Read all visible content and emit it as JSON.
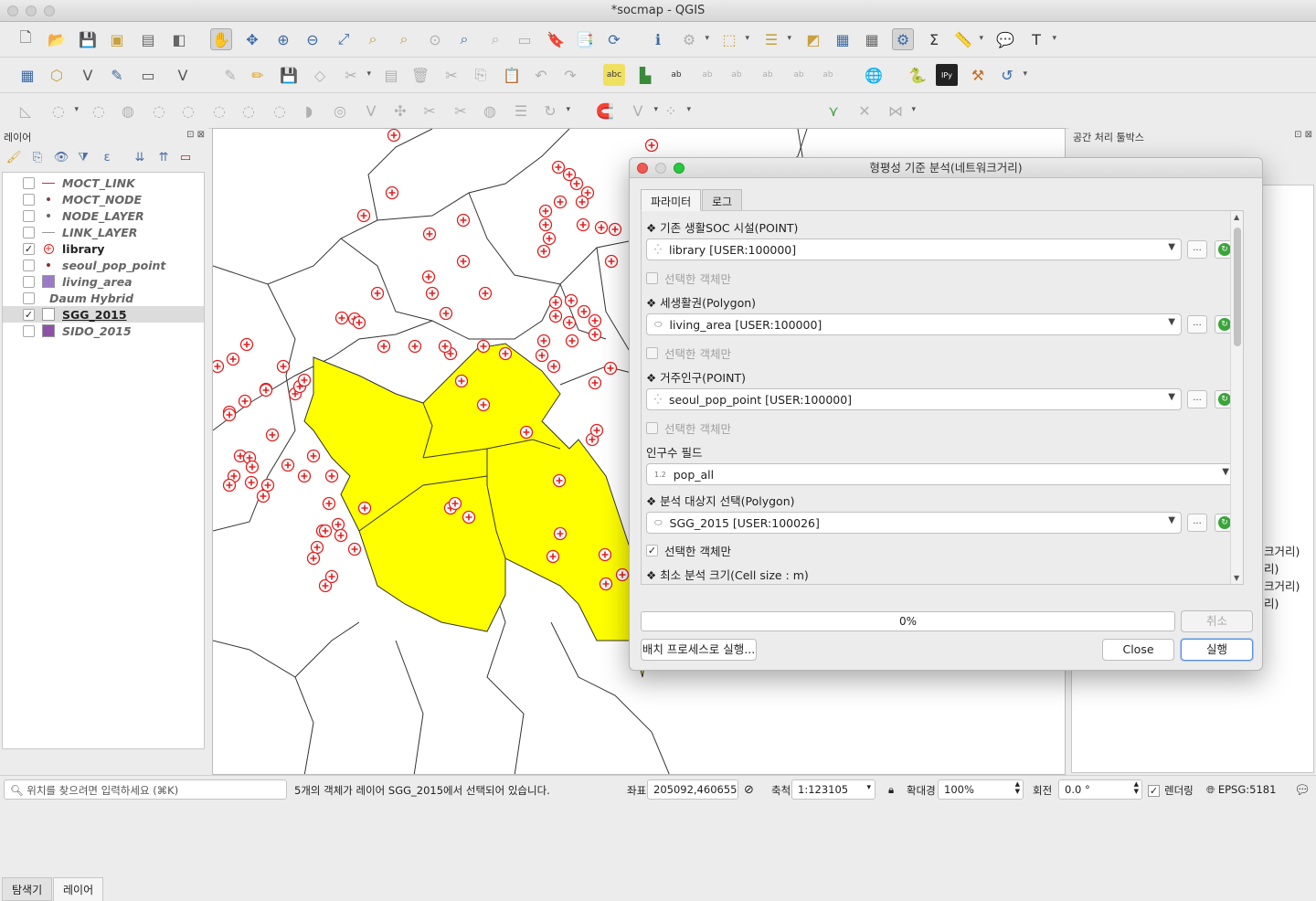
{
  "window": {
    "title": "*socmap - QGIS"
  },
  "toolbar": {
    "scale_value": "12",
    "unit": "px"
  },
  "layers_panel": {
    "title": "레이어",
    "items": [
      {
        "name": "MOCT_LINK",
        "checked": false,
        "symbol": "line",
        "color": "#b03a3a"
      },
      {
        "name": "MOCT_NODE",
        "checked": false,
        "symbol": "dot",
        "color": "#8a4040"
      },
      {
        "name": "NODE_LAYER",
        "checked": false,
        "symbol": "dot",
        "color": "#666666"
      },
      {
        "name": "LINK_LAYER",
        "checked": false,
        "symbol": "line",
        "color": "#999999"
      },
      {
        "name": "library",
        "checked": true,
        "symbol": "cross",
        "color": "#e02020"
      },
      {
        "name": "seoul_pop_point",
        "checked": false,
        "symbol": "dot",
        "color": "#8a3030"
      },
      {
        "name": "living_area",
        "checked": false,
        "symbol": "square",
        "color": "#9b7bc7"
      },
      {
        "name": "Daum Hybrid",
        "checked": false,
        "symbol": "none",
        "color": ""
      },
      {
        "name": "SGG_2015",
        "checked": true,
        "symbol": "square",
        "color": "#ffffff"
      },
      {
        "name": "SIDO_2015",
        "checked": false,
        "symbol": "square",
        "color": "#8e4fa8"
      }
    ],
    "tabs": [
      "탐색기",
      "레이어"
    ]
  },
  "right_panel": {
    "title": "공간 처리 툴박스",
    "items": [
      "크거리)",
      "리)",
      "크거리)",
      "리)"
    ]
  },
  "dialog": {
    "title": "형평성 기준 분석(네트워크거리)",
    "tabs": [
      "파라미터",
      "로그"
    ],
    "params": {
      "soc_label": "❖ 기존 생활SOC 시설(POINT)",
      "soc_value": "library [USER:100000]",
      "soc_selected_only": "선택한 객체만",
      "living_label": "❖ 세생활권(Polygon)",
      "living_value": "living_area [USER:100000]",
      "living_selected_only": "선택한 객체만",
      "pop_label": "❖ 거주인구(POINT)",
      "pop_value": "seoul_pop_point [USER:100000]",
      "pop_selected_only": "선택한 객체만",
      "popfield_label": "인구수 필드",
      "popfield_value": "pop_all",
      "popfield_type": "1.2",
      "target_label": "❖ 분석 대상지 선택(Polygon)",
      "target_value": "SGG_2015 [USER:100026]",
      "target_selected_only": "선택한 객체만",
      "cell_label": "❖ 최소 분석 크기(Cell size : m)",
      "more_btn": "..."
    },
    "progress": "0%",
    "progress_value": 0,
    "cancel_btn": "취소",
    "batch_btn": "배치 프로세스로 실행...",
    "close_btn": "Close",
    "run_btn": "실행"
  },
  "statusbar": {
    "search_placeholder": "위치를 찾으려면 입력하세요 (⌘K)",
    "message": "5개의 객체가 레이어 SGG_2015에서 선택되어 있습니다.",
    "coord_label": "좌표",
    "coord_value": "205092,460655",
    "scale_label": "축척",
    "scale_value": "1:123105",
    "magnify_label": "확대경",
    "magnify_value": "100%",
    "rotation_label": "회전",
    "rotation_value": "0.0 °",
    "render_label": "렌더링",
    "crs": "EPSG:5181"
  }
}
